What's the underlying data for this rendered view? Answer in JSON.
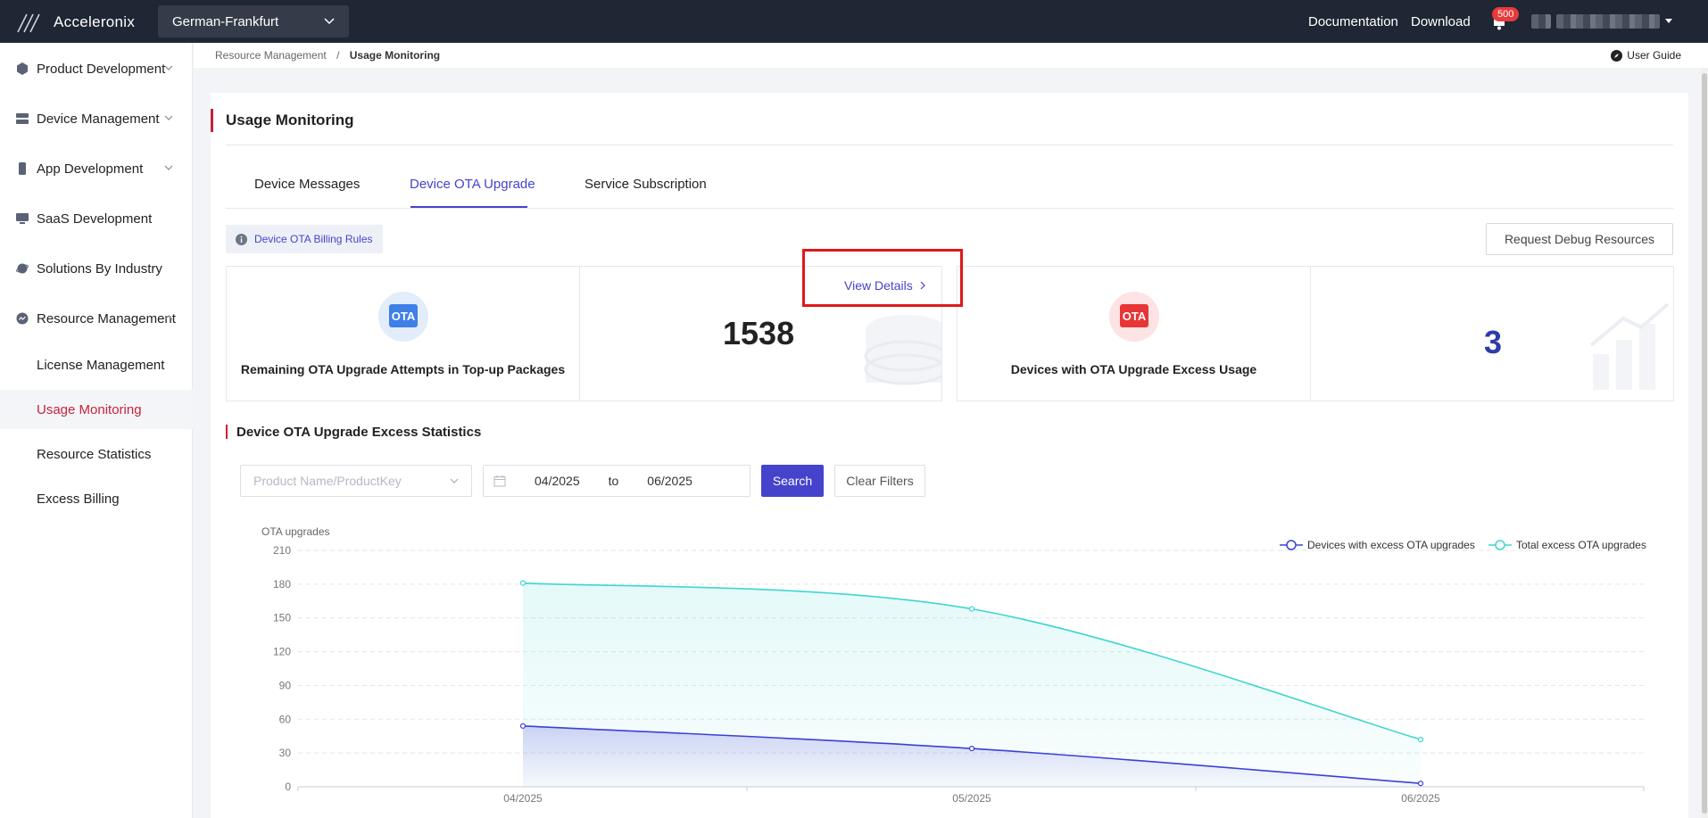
{
  "topbar": {
    "brand": "Acceleronix",
    "region": "German-Frankfurt",
    "documentation": "Documentation",
    "download": "Download",
    "notification_count": "500"
  },
  "sidebar": {
    "items": [
      {
        "label": "Product Development",
        "icon": "cube-icon"
      },
      {
        "label": "Device Management",
        "icon": "server-icon"
      },
      {
        "label": "App Development",
        "icon": "phone-icon"
      },
      {
        "label": "SaaS Development",
        "icon": "monitor-icon"
      },
      {
        "label": "Solutions By Industry",
        "icon": "planet-icon"
      },
      {
        "label": "Resource Management",
        "icon": "cloud-icon"
      }
    ],
    "subitems": [
      "License Management",
      "Usage Monitoring",
      "Resource Statistics",
      "Excess Billing"
    ]
  },
  "breadcrumb": {
    "parent": "Resource Management",
    "sep": "/",
    "current": "Usage Monitoring"
  },
  "user_guide": "User Guide",
  "page": {
    "title": "Usage Monitoring",
    "tabs": [
      "Device Messages",
      "Device OTA Upgrade",
      "Service Subscription"
    ],
    "active_tab": "Device OTA Upgrade",
    "billing_rules": "Device OTA Billing Rules",
    "request_debug": "Request Debug Resources",
    "cards": {
      "remaining_label": "Remaining OTA Upgrade Attempts in Top-up Packages",
      "remaining_value": "1538",
      "view_details": "View Details",
      "excess_label": "Devices with OTA Upgrade Excess Usage",
      "excess_value": "3",
      "ota_badge": "OTA"
    },
    "section_title": "Device OTA Upgrade Excess Statistics",
    "filters": {
      "product_placeholder": "Product Name/ProductKey",
      "date_from": "04/2025",
      "date_sep": "to",
      "date_to": "06/2025",
      "search": "Search",
      "clear": "Clear Filters"
    }
  },
  "colors": {
    "accent": "#4543cc",
    "brand_red": "#c4243a",
    "series1": "#3c3fd6",
    "series2": "#3fd6cf"
  },
  "chart_data": {
    "type": "line",
    "ylabel": "OTA upgrades",
    "categories": [
      "04/2025",
      "05/2025",
      "06/2025"
    ],
    "yticks": [
      0,
      30,
      60,
      90,
      120,
      150,
      180,
      210
    ],
    "ylim": [
      0,
      210
    ],
    "legend_position": "top-right",
    "grid": true,
    "series": [
      {
        "name": "Devices with excess OTA upgrades",
        "values": [
          54,
          34,
          3
        ],
        "color": "#3c3fd6"
      },
      {
        "name": "Total excess OTA upgrades",
        "values": [
          181,
          158,
          42
        ],
        "color": "#3fd6cf"
      }
    ]
  }
}
